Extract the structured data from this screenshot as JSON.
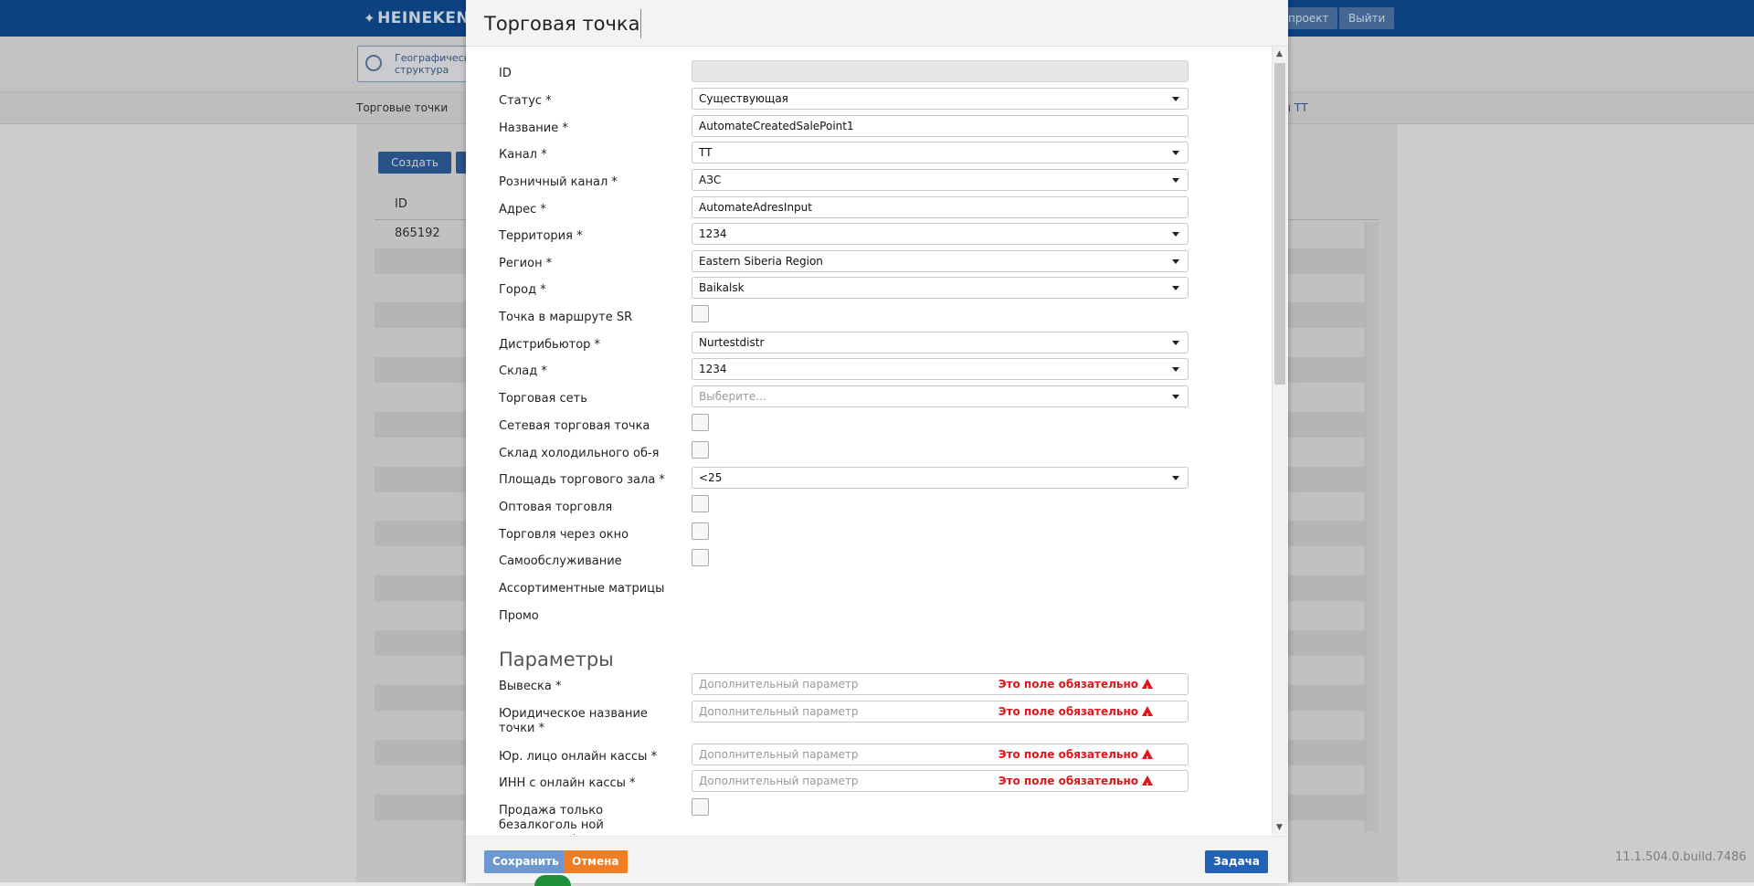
{
  "app": {
    "logo": "HEINEKEN",
    "top_buttons": [
      "проект",
      "Выйти"
    ],
    "geo_button": "Географическая структура",
    "subnav_left": "Торговые точки",
    "subnav_right": "сы ТТ",
    "create_label": "Создать",
    "table_header_id": "ID",
    "table_row_id": "865192",
    "version": "11.1.504.0.build.7486"
  },
  "modal": {
    "title": "Торговая точка",
    "fields": {
      "id": {
        "label": "ID",
        "value": ""
      },
      "status": {
        "label": "Статус *",
        "value": "Существующая"
      },
      "name": {
        "label": "Название *",
        "value": "AutomateCreatedSalePoint1"
      },
      "channel": {
        "label": "Канал *",
        "value": "TT"
      },
      "retail_channel": {
        "label": "Розничный канал *",
        "value": "АЗС"
      },
      "address": {
        "label": "Адрес *",
        "value": "AutomateAdresInput"
      },
      "territory": {
        "label": "Территория *",
        "value": "1234"
      },
      "region": {
        "label": "Регион *",
        "value": "Eastern Siberia Region"
      },
      "city": {
        "label": "Город *",
        "value": "Baikalsk"
      },
      "sr_route": {
        "label": "Точка в маршруте SR",
        "checked": false
      },
      "distributor": {
        "label": "Дистрибьютор *",
        "value": "Nurtestdistr"
      },
      "warehouse": {
        "label": "Склад *",
        "value": "1234"
      },
      "trade_network": {
        "label": "Торговая сеть",
        "placeholder": "Выберите..."
      },
      "network_outlet": {
        "label": "Сетевая торговая точка",
        "checked": false
      },
      "cold_storage": {
        "label": "Склад холодильного об-я",
        "checked": false
      },
      "floor_area": {
        "label": "Площадь торгового зала *",
        "value": "<25"
      },
      "wholesale": {
        "label": "Оптовая торговля",
        "checked": false
      },
      "window_trade": {
        "label": "Торговля через окно",
        "checked": false
      },
      "self_service": {
        "label": "Самообслуживание",
        "checked": false
      },
      "assortment": {
        "label": "Ассортиментные матрицы"
      },
      "promo": {
        "label": "Промо"
      }
    },
    "params_title": "Параметры",
    "params": {
      "placeholder": "Дополнительный параметр",
      "error": "Это поле обязательно",
      "signboard": {
        "label": "Вывеска *"
      },
      "legal_name": {
        "label": "Юридическое название точки *"
      },
      "legal_entity_kassa": {
        "label": "Юр. лицо онлайн кассы *"
      },
      "inn_kassa": {
        "label": "ИНН с онлайн кассы *"
      },
      "non_alcohol_only": {
        "label": "Продажа только безалкоголь ной продукции *",
        "checked": false
      }
    },
    "footer": {
      "save": "Сохранить",
      "cancel": "Отмена",
      "task": "Задача"
    }
  }
}
